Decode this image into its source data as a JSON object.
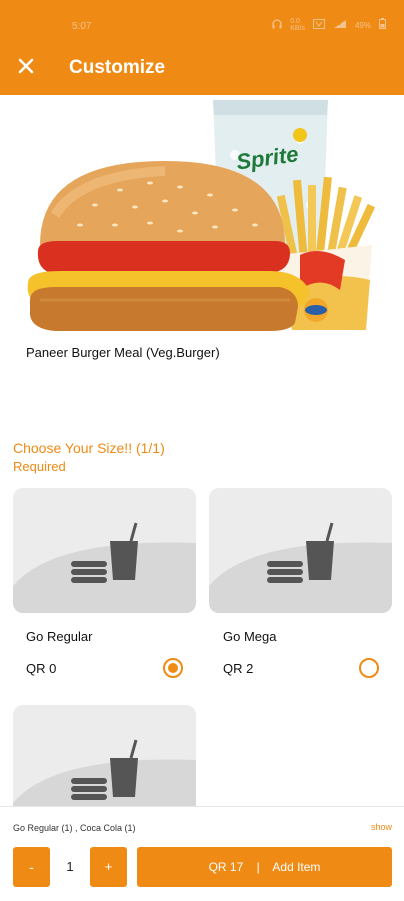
{
  "status_bar": {
    "time": "5:07",
    "battery": "49%"
  },
  "header": {
    "title": "Customize"
  },
  "product": {
    "name": "Paneer Burger Meal (Veg.Burger)",
    "cup_brand": "Sprite"
  },
  "size_section": {
    "title": "Choose Your Size!! (1/1)",
    "required": "Required"
  },
  "options": [
    {
      "label": "Go Regular",
      "price": "QR 0",
      "selected": true
    },
    {
      "label": "Go Mega",
      "price": "QR 2",
      "selected": false
    }
  ],
  "footer": {
    "summary": "Go Regular (1) , Coca Cola (1)",
    "show": "show",
    "minus": "-",
    "quantity": "1",
    "plus": "+",
    "total": "QR 17",
    "divider": "|",
    "add_item": "Add Item"
  },
  "colors": {
    "accent": "#ef8a14",
    "card_bg": "#ececec",
    "icon": "#555555"
  }
}
